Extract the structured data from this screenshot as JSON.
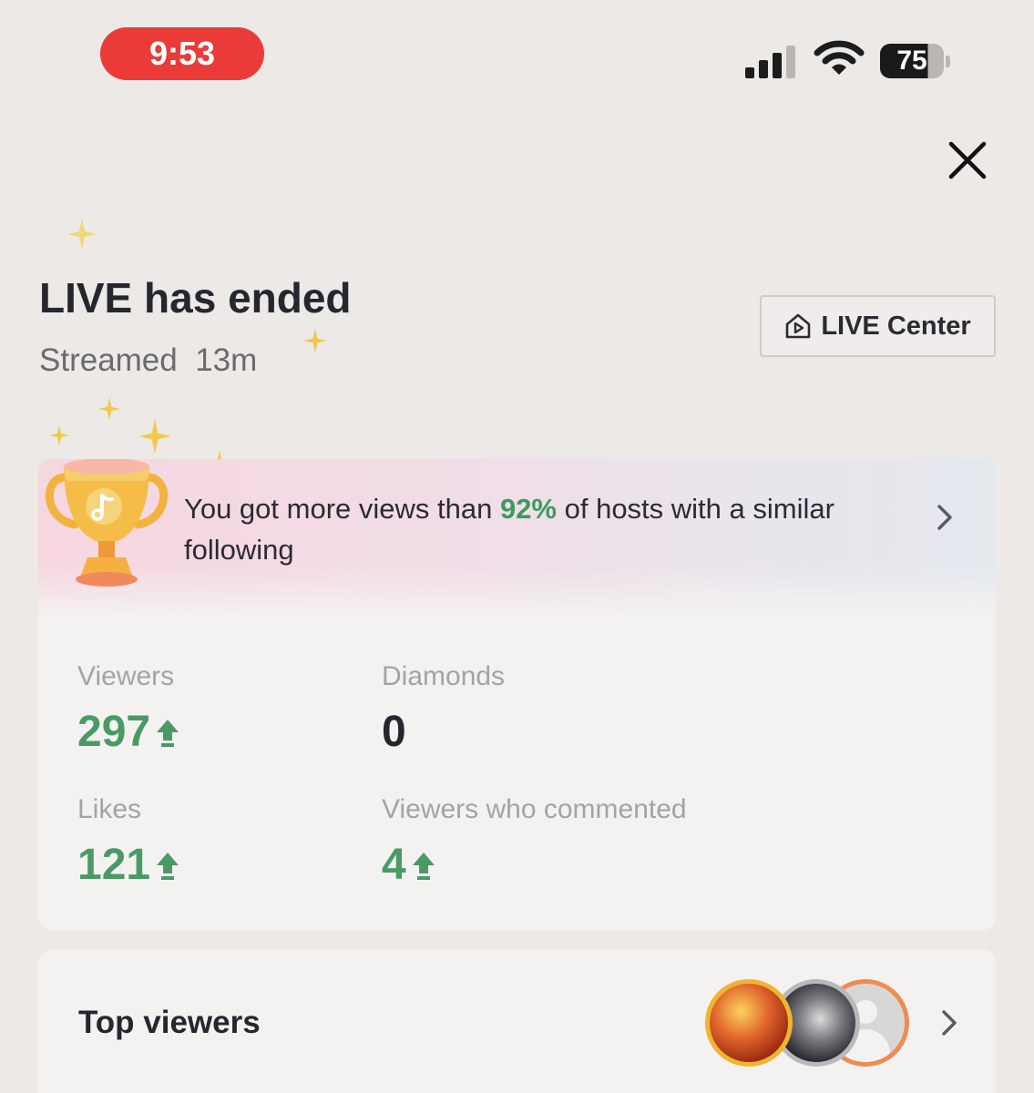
{
  "status_bar": {
    "time": "9:53",
    "battery_level": "75",
    "icons": [
      "signal-icon",
      "wifi-icon",
      "battery-icon"
    ]
  },
  "header": {
    "close_icon": "close-icon"
  },
  "summary": {
    "title": "LIVE has ended",
    "streamed_label": "Streamed",
    "duration": "13m"
  },
  "live_center_button": {
    "label": "LIVE Center",
    "icon": "house-play-icon"
  },
  "banner": {
    "text_before": "You got more views than ",
    "percent": "92%",
    "text_after": " of hosts with a similar following",
    "icon": "trophy-icon"
  },
  "stats": [
    {
      "label": "Viewers",
      "value": "297",
      "trend": "up",
      "color": "#4a9a66"
    },
    {
      "label": "Diamonds",
      "value": "0",
      "trend": "none",
      "color": "#26262f"
    },
    {
      "label": "Likes",
      "value": "121",
      "trend": "up",
      "color": "#4a9a66"
    },
    {
      "label": "Viewers who commented",
      "value": "4",
      "trend": "up",
      "color": "#4a9a66"
    }
  ],
  "top_viewers": {
    "label": "Top viewers",
    "avatar_count": 3
  },
  "colors": {
    "accent_red": "#ea3b38",
    "positive_green": "#4a9a66",
    "background": "#ece9e7"
  }
}
